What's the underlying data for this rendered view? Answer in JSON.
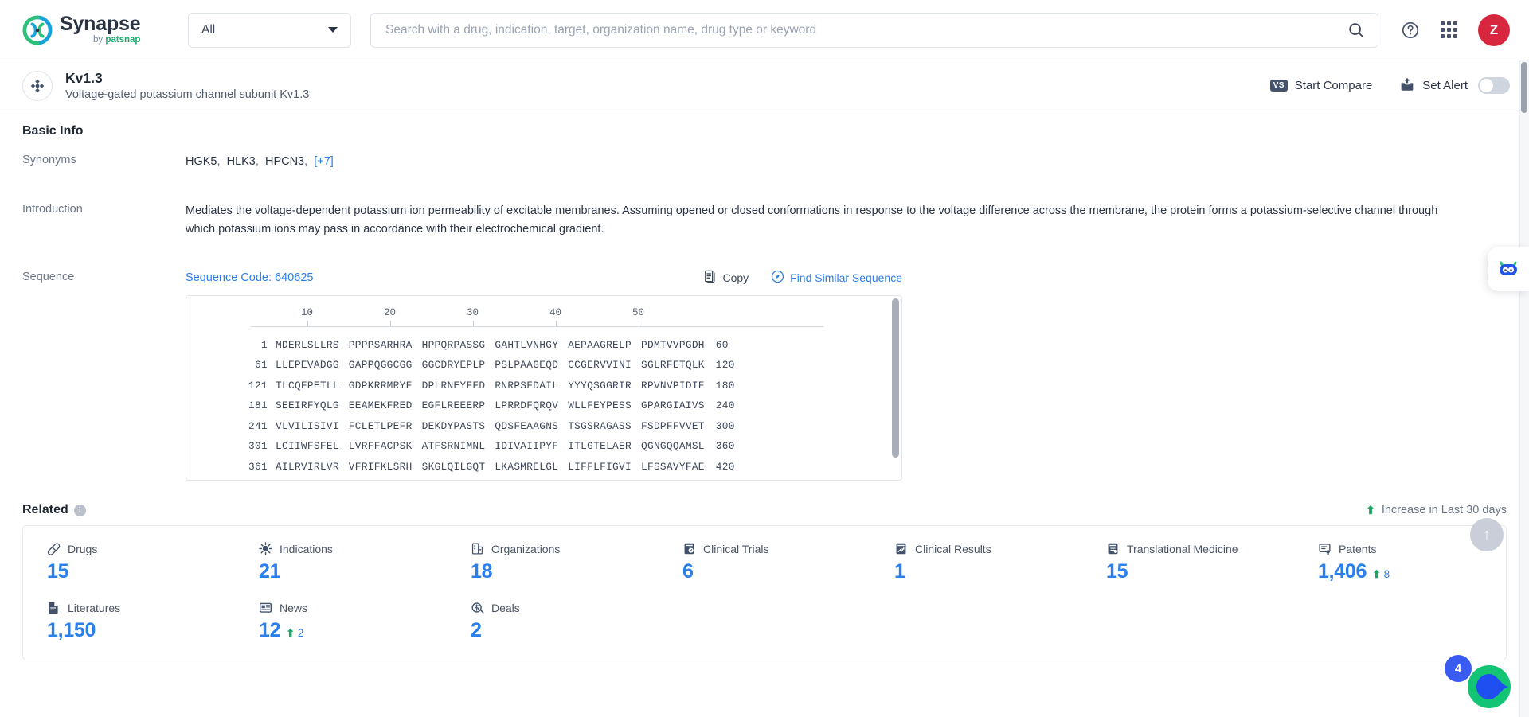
{
  "header": {
    "logo_name": "Synapse",
    "logo_sub_prefix": "by ",
    "logo_sub_brand": "patsnap",
    "scope_selected": "All",
    "search_placeholder": "Search with a drug, indication, target, organization name, drug type or keyword",
    "search_value": "",
    "avatar_initial": "Z",
    "help_icon": "question-circle-icon",
    "apps_icon": "grid-apps-icon",
    "search_icon": "search-icon"
  },
  "entity": {
    "icon": "target-icon",
    "title": "Kv1.3",
    "subtitle": "Voltage-gated potassium channel subunit Kv1.3",
    "compare_label": "Start Compare",
    "compare_badge": "VS",
    "alert_label": "Set Alert",
    "alert_icon": "alert-inbox-icon",
    "alert_toggle_on": false
  },
  "basic_info": {
    "section_title": "Basic Info",
    "synonyms_label": "Synonyms",
    "synonyms": [
      "HGK5",
      "HLK3",
      "HPCN3"
    ],
    "synonyms_more": "[+7]",
    "introduction_label": "Introduction",
    "introduction": "Mediates the voltage-dependent potassium ion permeability of excitable membranes. Assuming opened or closed conformations in response to the voltage difference across the membrane, the protein forms a potassium-selective channel through which potassium ions may pass in accordance with their electrochemical gradient.",
    "sequence_label": "Sequence",
    "sequence_code": "Sequence Code: 640625",
    "copy_label": "Copy",
    "copy_icon": "copy-icon",
    "find_similar_label": "Find Similar Sequence",
    "find_similar_icon": "compass-icon"
  },
  "sequence_viewer": {
    "ruler_ticks": [
      "10",
      "20",
      "30",
      "40",
      "50"
    ],
    "lines": [
      {
        "start": "1",
        "chunks": [
          "MDERLSLLRS",
          "PPPPSARHRA",
          "HPPQRPASSG",
          "GAHTLVNHGY",
          "AEPAAGRELP",
          "PDMTVVPGDH"
        ],
        "end": "60"
      },
      {
        "start": "61",
        "chunks": [
          "LLEPEVADGG",
          "GAPPQGGCGG",
          "GGCDRYEPLP",
          "PSLPAAGEQD",
          "CCGERVVINI",
          "SGLRFETQLK"
        ],
        "end": "120"
      },
      {
        "start": "121",
        "chunks": [
          "TLCQFPETLL",
          "GDPKRRMRYF",
          "DPLRNEYFFD",
          "RNRPSFDAIL",
          "YYYQSGGRIR",
          "RPVNVPIDIF"
        ],
        "end": "180"
      },
      {
        "start": "181",
        "chunks": [
          "SEEIRFYQLG",
          "EEAMEKFRED",
          "EGFLREEERP",
          "LPRRDFQRQV",
          "WLLFEYPESS",
          "GPARGIAIVS"
        ],
        "end": "240"
      },
      {
        "start": "241",
        "chunks": [
          "VLVILISIVI",
          "FCLETLPEFR",
          "DEKDYPASTS",
          "QDSFEAAGNS",
          "TSGSRAGASS",
          "FSDPFFVVET"
        ],
        "end": "300"
      },
      {
        "start": "301",
        "chunks": [
          "LCIIWFSFEL",
          "LVRFFACPSK",
          "ATFSRNIMNL",
          "IDIVAIIPYF",
          "ITLGTELAER",
          "QGNGQQAMSL"
        ],
        "end": "360"
      },
      {
        "start": "361",
        "chunks": [
          "AILRVIRLVR",
          "VFRIFKLSRH",
          "SKGLQILGQT",
          "LKASMRELGL",
          "LIFFLFIGVI",
          "LFSSAVYFAE"
        ],
        "end": "420"
      }
    ]
  },
  "related": {
    "title": "Related",
    "info_icon": "info-icon",
    "legend_label": "Increase in Last 30 days",
    "legend_icon": "up-arrow-icon",
    "stats": [
      {
        "label": "Drugs",
        "icon": "pill-icon",
        "value": "15",
        "delta": null
      },
      {
        "label": "Indications",
        "icon": "virus-icon",
        "value": "21",
        "delta": null
      },
      {
        "label": "Organizations",
        "icon": "building-icon",
        "value": "18",
        "delta": null
      },
      {
        "label": "Clinical Trials",
        "icon": "clinical-trial-icon",
        "value": "6",
        "delta": null
      },
      {
        "label": "Clinical Results",
        "icon": "clinical-result-icon",
        "value": "1",
        "delta": null
      },
      {
        "label": "Translational Medicine",
        "icon": "translational-icon",
        "value": "15",
        "delta": null
      },
      {
        "label": "Patents",
        "icon": "patent-icon",
        "value": "1,406",
        "delta": "8"
      },
      {
        "label": "Literatures",
        "icon": "literature-icon",
        "value": "1,150",
        "delta": null
      },
      {
        "label": "News",
        "icon": "news-icon",
        "value": "12",
        "delta": "2"
      },
      {
        "label": "Deals",
        "icon": "deal-icon",
        "value": "2",
        "delta": null
      }
    ]
  },
  "floaters": {
    "bot_icon": "ai-robot-icon",
    "scroll_top_icon": "arrow-up-icon",
    "chat_icon": "chat-bubble-icon",
    "chat_badge": "4"
  },
  "colors": {
    "accent_blue": "#2a7fea",
    "increase_green": "#19a463",
    "avatar_red": "#d7263d",
    "brand_green": "#13b06e"
  }
}
